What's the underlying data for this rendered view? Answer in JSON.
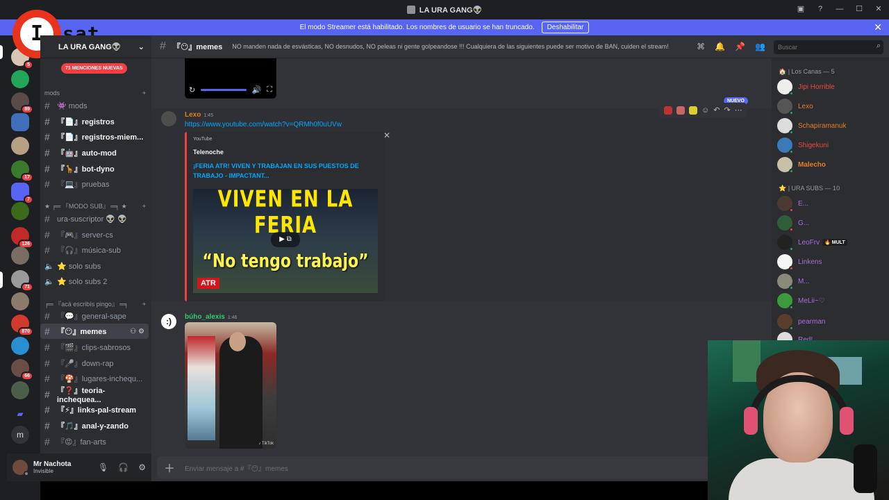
{
  "window": {
    "title": "LA URA GANG👽"
  },
  "banner": {
    "text": "El modo Streamer está habilitado. Los nombres de usuario se han truncado.",
    "button": "Deshabilitar",
    "close": "✕"
  },
  "logo": {
    "mark": "I",
    "text": "sat"
  },
  "rail": {
    "badges": [
      "5",
      "89",
      "17",
      "7",
      "126",
      "71",
      "870",
      "66"
    ],
    "bottom_letter": "m"
  },
  "server": {
    "name": "LA URA GANG👽",
    "mentions": "71 MENCIONES NUEVAS"
  },
  "categories": {
    "mods": "mods",
    "modo_sub": "★ ╒═ 『MODO SUB』 ═╕ ★",
    "aca": "╒═ 『acá escribís pingo』 ═╕"
  },
  "channels": [
    {
      "label": "👾 mods",
      "type": "text",
      "bold": false
    },
    {
      "label": "『📄』registros",
      "type": "text",
      "bold": true
    },
    {
      "label": "『📄』registros-miem...",
      "type": "text",
      "bold": true
    },
    {
      "label": "『🤖』auto-mod",
      "type": "text",
      "bold": true
    },
    {
      "label": "『🦒』bot-dyno",
      "type": "text",
      "bold": true
    },
    {
      "label": "『💻』pruebas",
      "type": "text",
      "bold": false
    },
    {
      "label": "ura-suscriptor 👽 👽",
      "type": "text",
      "bold": false
    },
    {
      "label": "『🎮』server-cs",
      "type": "text",
      "bold": false
    },
    {
      "label": "『🎧』música-sub",
      "type": "text",
      "bold": false
    },
    {
      "label": "⭐ solo subs",
      "type": "voice",
      "bold": false
    },
    {
      "label": "⭐ solo subs 2",
      "type": "voice",
      "bold": false
    },
    {
      "label": "『💬』general-sape",
      "type": "text",
      "bold": false
    },
    {
      "label": "『😶』memes",
      "type": "text",
      "bold": true
    },
    {
      "label": "『🎬』clips-sabrosos",
      "type": "text",
      "bold": false
    },
    {
      "label": "『🎤』down-rap",
      "type": "text",
      "bold": false
    },
    {
      "label": "『🍄』lugares-inchequ...",
      "type": "text",
      "bold": false
    },
    {
      "label": "『❓』teoria-inchequea...",
      "type": "text",
      "bold": true
    },
    {
      "label": "『⚡』links-pal-stream",
      "type": "text",
      "bold": true
    },
    {
      "label": "『🎵』anal-y-zando",
      "type": "text",
      "bold": true
    },
    {
      "label": "『😡』fan-arts",
      "type": "text",
      "bold": false
    }
  ],
  "user": {
    "name": "Mr Nachota",
    "status": "Invisible"
  },
  "topbar": {
    "channel": "『😶』memes",
    "topic": "NO manden nada de esvásticas, NO desnudos, NO peleas ni gente golpeandose !!! Cualquiera de las siguientes puede ser motivo de BAN, cuiden el stream!",
    "search_placeholder": "Buscar"
  },
  "messages": [
    {
      "author": "Lexo",
      "time": "1:45",
      "link": "https://www.youtube.com/watch?v=QRMh0f0uUVw",
      "embed": {
        "provider": "YouTube",
        "author": "Telenoche",
        "title": "¡FERIA ATR! VIVEN Y TRABAJAN EN SUS PUESTOS DE TRABAJO - IMPACTANT...",
        "thumb_top": "VIVEN EN LA FERIA",
        "thumb_bottom": "“No tengo trabajo”",
        "thumb_badge": "ATR"
      },
      "new_badge": "NUEVO"
    },
    {
      "author": "búho_alexis",
      "time": "1:46",
      "image_watermark": "♪ TikTok"
    }
  ],
  "composer": {
    "placeholder": "Enviar mensaje a #『😶』memes"
  },
  "members": {
    "groups": [
      {
        "header": "🏠 | Los Canas — 5",
        "items": [
          {
            "name": "Jipi Horrible",
            "color": "#e74c3c"
          },
          {
            "name": "Lexo",
            "color": "#e67e22"
          },
          {
            "name": "Schapiramanuk",
            "color": "#e67e22"
          },
          {
            "name": "Shigekuni",
            "color": "#e74c3c"
          },
          {
            "name": "Malecho",
            "color": "#e67e22"
          }
        ]
      },
      {
        "header": "⭐ | URA SUBS — 10",
        "items": [
          {
            "name": "E...",
            "color": "#a46fd8"
          },
          {
            "name": "G...",
            "color": "#a46fd8"
          },
          {
            "name": "LeoFrv",
            "color": "#a46fd8",
            "tag": "🔥 MULT"
          },
          {
            "name": "Linkens",
            "color": "#a46fd8"
          },
          {
            "name": "M...",
            "color": "#a46fd8"
          },
          {
            "name": "MeLii~♡",
            "color": "#a46fd8"
          },
          {
            "name": "pearman",
            "color": "#a46fd8"
          },
          {
            "name": "Red!",
            "color": "#a46fd8"
          }
        ]
      }
    ]
  },
  "colors": {
    "accent": "#5865f2",
    "danger": "#f23f43",
    "link": "#00a8fc"
  }
}
